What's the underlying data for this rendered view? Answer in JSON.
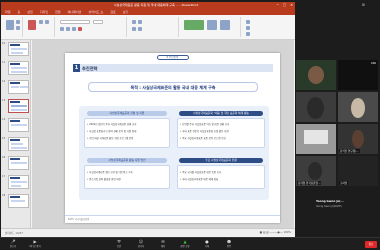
{
  "ppt": {
    "title": "사실상국제표준 활동 지원 및 국내 대응체계 구축 ... - PowerPoint",
    "tabs": [
      "파일",
      "홈",
      "삽입",
      "디자인",
      "전환",
      "애니메이션",
      "슬라이드 쇼",
      "검토",
      "보기"
    ],
    "status_left": "슬라이드 13/27",
    "status_right": "■ ▤ ▥ ─────●── 100%"
  },
  "slide": {
    "section_tag": "Ⅱ 추진전략",
    "section_num": "1",
    "section_title": "추진전략",
    "goal": "목적 : 사실상국제표준의 활동 국내 대응 체계 구축",
    "pill_left_top": "사실상국제표준화 현황 및 지원",
    "pill_right_top": "사실상국제표준화 \"대응 및 국민 표준화 체계 활동",
    "bullets_left": [
      "• 2021년 상반기 주요 사실상국제표준 현황 조사",
      "• 사실상 표준화기구 참여 현황 분석 및 지원 확대",
      "• 기업 대상 국제표준 활동 지원 프로그램 운영"
    ],
    "bullets_right": [
      "• 산업별 주요 사실상표준 이슈 및 대응 현황 조사",
      "• 국내 표준 전문가 사실상표준화 포럼 활동 지원",
      "• 주요 사실상국제표준 표준 전략 로드맵 수립"
    ],
    "pill_left_bottom": "사실상국제표준화 활동 지원 방안",
    "pill_right_bottom": "주요 사실상국제표준화 현황",
    "bullets_left2": [
      "• 사실상국제표준 정보 공유 및 네트워크 구축",
      "• 중소기업 참여 활성화 방안 마련"
    ],
    "bullets_right2": [
      "• 주요 국가별 사실상표준 대응 동향 조사",
      "• 국내 사실상국제표준 대응 체계 강화"
    ],
    "footer": "KATS 국가기술표준원"
  },
  "gallery": {
    "tiles": [
      {
        "name": "",
        "label": ""
      },
      {
        "name": "",
        "label": "KPA"
      },
      {
        "name": "",
        "label": ""
      },
      {
        "name": "",
        "label": ""
      },
      {
        "name": "",
        "label": ""
      },
      {
        "name": "윤석진 연구원(...",
        "label": ""
      },
      {
        "name": "김가영 한국표준협...",
        "label": ""
      },
      {
        "name": "조하영",
        "label": ""
      }
    ],
    "speaker_name": "Yeong Gwon Jo(...",
    "speaker_sub": "Yeong Gwon Jo(KGTP)"
  },
  "taskbar": {
    "items": [
      "음소거",
      "비디오 중지",
      "보안",
      "참가자",
      "채팅",
      "화면 공유",
      "기록",
      "반응"
    ],
    "icons": [
      "mic-icon",
      "video-icon",
      "shield-icon",
      "people-icon",
      "chat-icon",
      "share-icon",
      "record-icon",
      "emoji-icon"
    ],
    "leave": "종료"
  }
}
